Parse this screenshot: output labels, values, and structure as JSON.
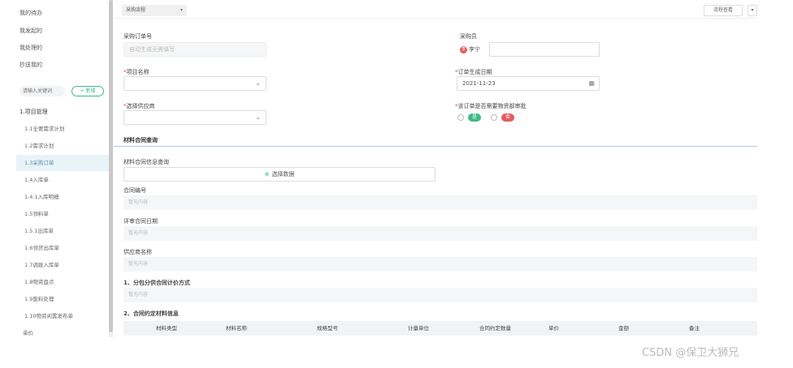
{
  "sidebar": {
    "links": [
      "我的待办",
      "我发起的",
      "我处理的",
      "抄送我的"
    ],
    "search_placeholder": "请输入关键词",
    "new_button": "+ 新增",
    "group": "1.项目管理",
    "items": [
      {
        "label": "1.1全要需求计划",
        "active": false
      },
      {
        "label": "1.2需求计划",
        "active": false
      },
      {
        "label": "1.3采购订单",
        "active": true
      },
      {
        "label": "1.4入库单",
        "active": false
      },
      {
        "label": "1.4.1入库明细",
        "active": false
      },
      {
        "label": "1.5领料单",
        "active": false
      },
      {
        "label": "1.5.1出库单",
        "active": false
      },
      {
        "label": "1.6领货出库单",
        "active": false
      },
      {
        "label": "1.7调拨入库单",
        "active": false
      },
      {
        "label": "1.8物资盘点",
        "active": false
      },
      {
        "label": "1.9废料处理",
        "active": false
      },
      {
        "label": "1.10物资闲置发布单",
        "active": false
      },
      {
        "label": "单价",
        "active": false
      }
    ]
  },
  "topbar": {
    "select_value": "采购流程",
    "right_button": "流程查看",
    "more": "▾"
  },
  "form": {
    "po_number": {
      "label": "采购订单号",
      "placeholder": "自动生成无需填写"
    },
    "purchaser": {
      "label": "采购员",
      "value": "李宁",
      "badge": "李"
    },
    "project": {
      "label": "项目名称",
      "required": "*"
    },
    "order_date": {
      "label": "订单生成日期",
      "required": "*",
      "value": "2021-11-23"
    },
    "supplier": {
      "label": "选择供应商",
      "required": "*"
    },
    "material_approval": {
      "label": "该订单是否需要物资部审批",
      "required": "*",
      "options": [
        "是",
        "否"
      ]
    }
  },
  "contract": {
    "section_title": "材料合同查询",
    "query_label": "材料合同信息查询",
    "select_button": "选择数据",
    "fields": [
      {
        "label": "合同编号",
        "placeholder": "暂无内容"
      },
      {
        "label": "评审合同日期",
        "placeholder": "暂无内容"
      },
      {
        "label": "供应商名称",
        "placeholder": "暂无内容"
      },
      {
        "label": "1、分包分供合同计价方式",
        "placeholder": "暂无内容"
      }
    ],
    "table_title": "2、合同约定材料信息",
    "columns": [
      "材料类型",
      "材料名称",
      "规格型号",
      "计量单位",
      "合同约定数量",
      "单价",
      "金额",
      "备注"
    ]
  },
  "watermark": "CSDN @保卫大狮兄",
  "colors": {
    "accent": "#3fba85",
    "danger": "#e25c5c",
    "active_bg": "#e8f4f8",
    "section_line": "#b9c6e6"
  }
}
